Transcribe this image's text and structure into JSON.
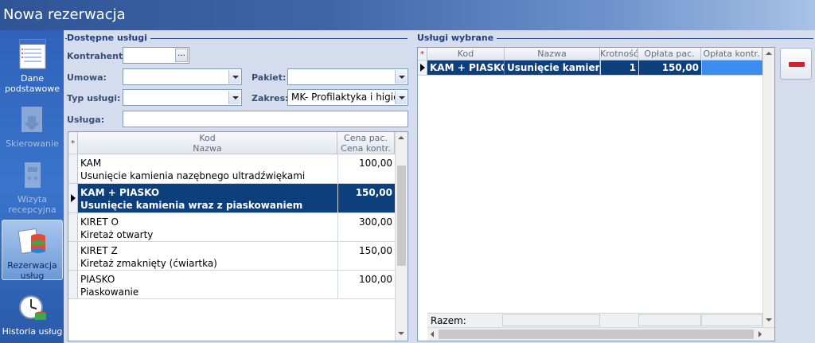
{
  "window": {
    "title": "Nowa rezerwacja"
  },
  "sidebar": {
    "items": [
      {
        "label_line1": "Dane",
        "label_line2": "podstawowe"
      },
      {
        "label_line1": "Skierowanie",
        "label_line2": ""
      },
      {
        "label_line1": "Wizyta",
        "label_line2": "recepcyjna"
      },
      {
        "label_line1": "Rezerwacja",
        "label_line2": "usług"
      },
      {
        "label_line1": "Historia usług",
        "label_line2": ""
      }
    ]
  },
  "available": {
    "group_title": "Dostępne usługi",
    "contractor_label": "Kontrahent:",
    "contractor_value": "",
    "contractor_button": "...",
    "contract_label": "Umowa:",
    "contract_value": "",
    "package_label": "Pakiet:",
    "package_value": "",
    "service_type_label": "Typ usługi:",
    "service_type_value": "",
    "scope_label": "Zakres:",
    "scope_value": "MK- Profilaktyka i higien",
    "service_label": "Usługa:",
    "service_value": "",
    "header_code": "Kod",
    "header_name": "Nazwa",
    "header_price_pat": "Cena pac.",
    "header_price_contr": "Cena kontr.",
    "rows": [
      {
        "code": "KAM",
        "name": "Usunięcie kamienia nazębnego ultradźwiękami",
        "price": "100,00"
      },
      {
        "code": "KAM + PIASKO",
        "name": "Usunięcie kamienia wraz z piaskowaniem",
        "price": "150,00"
      },
      {
        "code": "KIRET O",
        "name": "Kiretaż otwarty",
        "price": "300,00"
      },
      {
        "code": "KIRET Z",
        "name": "Kiretaż zmaknięty (ćwiartka)",
        "price": "150,00"
      },
      {
        "code": "PIASKO",
        "name": "Piaskowanie",
        "price": "100,00"
      }
    ],
    "selected_row": 1
  },
  "selected": {
    "group_title": "Usługi wybrane",
    "header_code": "Kod",
    "header_name": "Nazwa",
    "header_mult": "Krotność",
    "header_fee_pat": "Opłata pac.",
    "header_fee_contr": "Opłata kontr.",
    "rows": [
      {
        "code": "KAM + PIASKO",
        "name": "Usunięcie kamien...",
        "mult": "1",
        "fee_pat": "150,00",
        "fee_contr": ""
      }
    ],
    "total_label": "Razem:"
  },
  "colors": {
    "selection": "#0e3f7d",
    "remove": "#d2232a",
    "accent": "#1e3f80"
  }
}
